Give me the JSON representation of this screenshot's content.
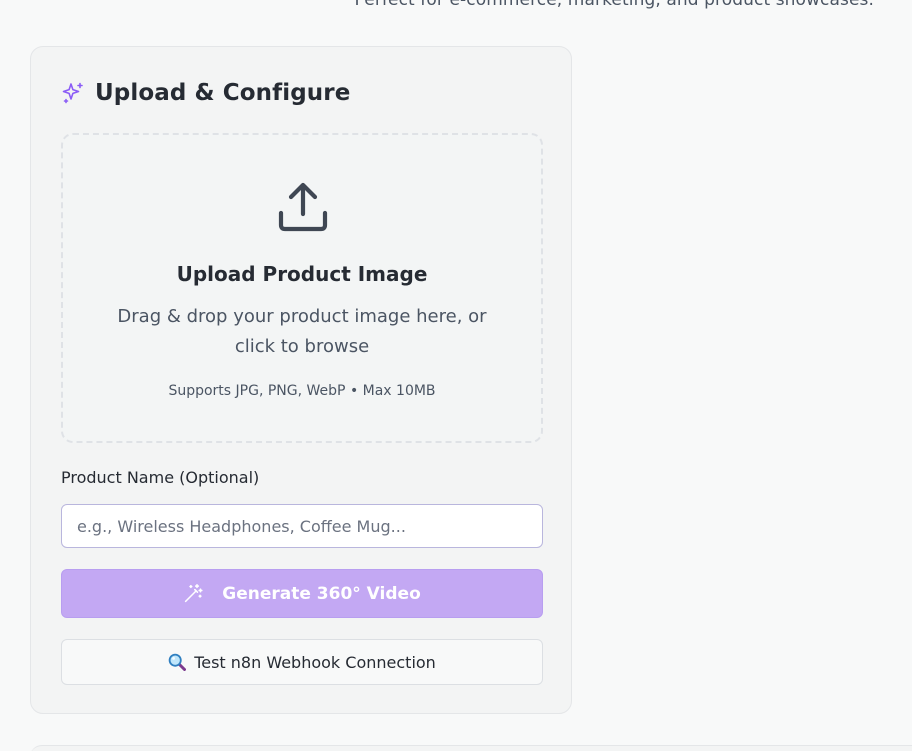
{
  "header": {
    "subtitle": "Perfect for e-commerce, marketing, and product showcases."
  },
  "card": {
    "title": "Upload & Configure",
    "title_icon": "sparkles-icon"
  },
  "dropzone": {
    "icon": "upload-icon",
    "title": "Upload Product Image",
    "description": "Drag & drop your product image here, or click to browse",
    "note": "Supports JPG, PNG, WebP • Max 10MB"
  },
  "product_name": {
    "label": "Product Name (Optional)",
    "value": "",
    "placeholder": "e.g., Wireless Headphones, Coffee Mug..."
  },
  "generate_button": {
    "label": "Generate 360° Video",
    "icon": "magic-wand-icon",
    "state": "disabled"
  },
  "test_button": {
    "label": "Test n8n Webhook Connection",
    "icon": "magnifier-icon"
  },
  "colors": {
    "accent": "#8b5cf6",
    "button_disabled_bg": "#c3a8f3",
    "text_primary": "#262b33",
    "text_secondary": "#4b5563"
  }
}
